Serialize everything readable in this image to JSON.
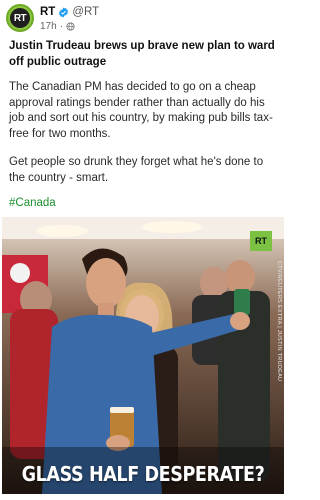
{
  "author": {
    "name": "RT",
    "handle": "@RT",
    "avatar_text": "RT",
    "time": "17h",
    "audience_icon": "globe-icon"
  },
  "post": {
    "title": "Justin Trudeau brews up brave new plan to ward off public outrage",
    "paragraph1": "The Canadian PM has decided to go on a cheap approval ratings bender rather than actually do his job and sort out his country, by making pub bills tax-free for two months.",
    "paragraph2": "Get people so drunk they forget what he's done to the country - smart.",
    "hashtag": "#Canada"
  },
  "media": {
    "caption": "GLASS HALF DESPERATE?",
    "badge": "RT",
    "credit": "CTV/REUTERS EXTRA | JUSTIN TRUDEAU"
  },
  "colors": {
    "accent_green": "#1b8f2e",
    "rt_green": "#7bc243",
    "verified_blue": "#1d9bf0"
  }
}
